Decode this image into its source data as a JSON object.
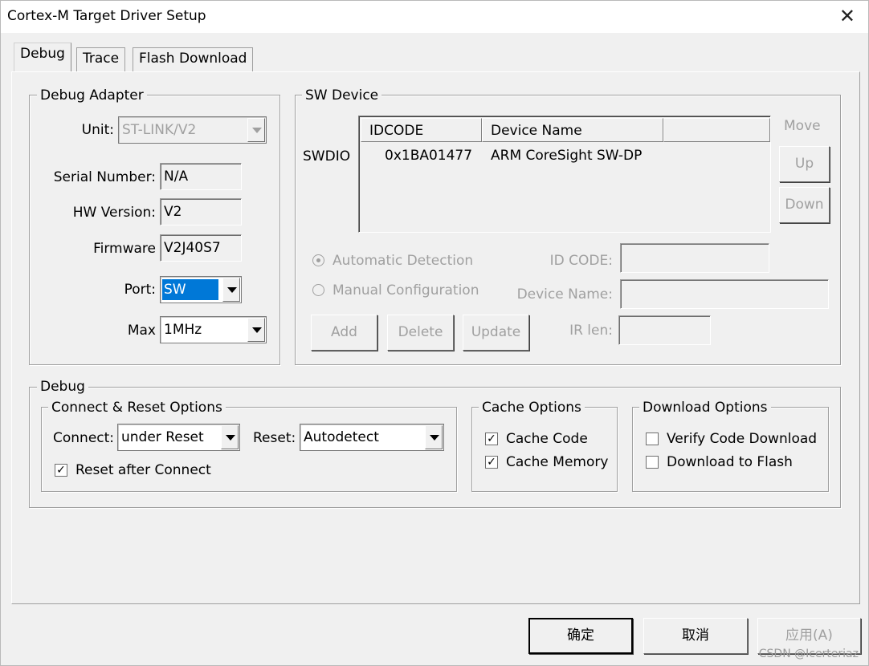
{
  "window": {
    "title": "Cortex-M Target Driver Setup",
    "close_glyph": "✕"
  },
  "tabs": [
    {
      "label": "Debug",
      "active": true
    },
    {
      "label": "Trace",
      "active": false
    },
    {
      "label": "Flash Download",
      "active": false
    }
  ],
  "debug_adapter": {
    "group_label": "Debug Adapter",
    "unit_label": "Unit:",
    "unit_value": "ST-LINK/V2",
    "serial_label": "Serial Number:",
    "serial_value": "N/A",
    "hw_label": "HW Version:",
    "hw_value": "V2",
    "fw_label": "Firmware",
    "fw_value": "V2J40S7",
    "port_label": "Port:",
    "port_value": "SW",
    "max_label": "Max",
    "max_value": "1MHz"
  },
  "sw_device": {
    "group_label": "SW Device",
    "swdio_label": "SWDIO",
    "columns": [
      "IDCODE",
      "Device Name"
    ],
    "rows": [
      {
        "idcode": "0x1BA01477",
        "device_name": "ARM CoreSight SW-DP"
      }
    ],
    "move_label": "Move",
    "up_label": "Up",
    "down_label": "Down",
    "auto_detect_label": "Automatic Detection",
    "manual_config_label": "Manual Configuration",
    "id_code_label": "ID CODE:",
    "device_name_label": "Device Name:",
    "ir_len_label": "IR len:",
    "add_label": "Add",
    "delete_label": "Delete",
    "update_label": "Update"
  },
  "debug": {
    "group_label": "Debug",
    "connect_reset": {
      "group_label": "Connect & Reset Options",
      "connect_label": "Connect:",
      "connect_value": "under Reset",
      "reset_label": "Reset:",
      "reset_value": "Autodetect",
      "reset_after_connect_label": "Reset after Connect",
      "reset_after_connect_checked": true
    },
    "cache": {
      "group_label": "Cache Options",
      "cache_code_label": "Cache Code",
      "cache_code_checked": true,
      "cache_memory_label": "Cache Memory",
      "cache_memory_checked": true
    },
    "download": {
      "group_label": "Download Options",
      "verify_label": "Verify Code Download",
      "verify_checked": false,
      "download_flash_label": "Download to Flash",
      "download_flash_checked": false
    }
  },
  "footer": {
    "ok_label": "确定",
    "cancel_label": "取消",
    "apply_label": "应用(A)"
  },
  "watermark": "CSDN @Icerteriaz"
}
